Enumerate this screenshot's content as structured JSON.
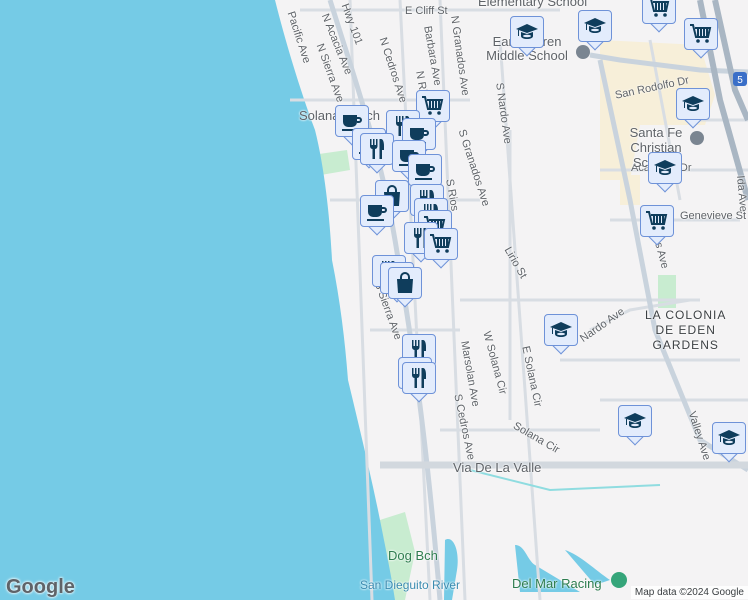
{
  "map": {
    "streets": [
      "E Cliff St",
      "Pacific Ave",
      "N Acacia Ave",
      "N Sierra Ave",
      "Hwy 101",
      "N Cedros Ave",
      "Barbara Ave",
      "N Granados Ave",
      "N Rios",
      "S Granados Ave",
      "S Nardo Ave",
      "San Rodolfo Dr",
      "Academy Dr",
      "Genevieve St",
      "Stevens Ave",
      "Ida Ave",
      "Lirio St",
      "S Sierra Ave",
      "S Cedros Ave",
      "Marsolan Ave",
      "W Solana Cir",
      "E Solana Cir",
      "Solana Cir",
      "Nardo Ave",
      "Valley Ave",
      "Via De La Valle",
      "S Rios"
    ],
    "places": [
      "Solana Beach",
      "Earl Warren Middle School",
      "Elementary School",
      "Santa Fe Christian Schools",
      "Dog Bch",
      "San Dieguito River",
      "Del Mar Racing"
    ],
    "neighborhood": [
      "LA COLONIA",
      "DE EDEN",
      "GARDENS"
    ],
    "highway_shield": "5",
    "marker_types": [
      "cafe",
      "restaurant",
      "grocery",
      "shopping",
      "school"
    ]
  },
  "footer": {
    "logo": "Google",
    "attribution": "Map data ©2024 Google"
  },
  "colors": {
    "water": "#75cbe6",
    "land": "#f4f3f4",
    "marker_bg": "#e3ecfc",
    "marker_border": "#6e92d8",
    "icon": "#0f3d5c",
    "school_area": "#f7efd9",
    "park": "#c8ecd0"
  }
}
